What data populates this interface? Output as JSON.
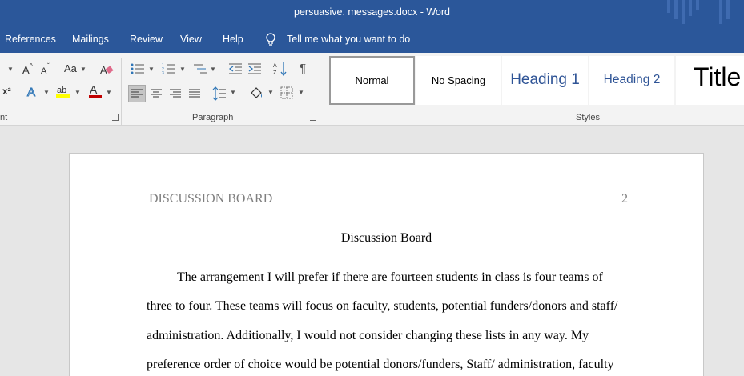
{
  "window": {
    "title": "persuasive. messages.docx  -  Word"
  },
  "ribbon_tabs": [
    {
      "label": "References"
    },
    {
      "label": "Mailings"
    },
    {
      "label": "Review"
    },
    {
      "label": "View"
    },
    {
      "label": "Help"
    }
  ],
  "tell_me": {
    "placeholder": "Tell me what you want to do"
  },
  "ribbon": {
    "font_group_label": "nt",
    "paragraph_group_label": "Paragraph",
    "styles_group_label": "Styles",
    "change_case_label": "Aa",
    "styles": [
      {
        "label": "Normal"
      },
      {
        "label": "No Spacing"
      },
      {
        "label": "Heading 1"
      },
      {
        "label": "Heading 2"
      },
      {
        "label": "Title"
      }
    ]
  },
  "document": {
    "header_left": "DISCUSSION BOARD",
    "page_number": "2",
    "title": "Discussion Board",
    "lines": [
      "The arrangement I will prefer if there are fourteen students in class is four teams of",
      "three to four. These teams will focus on faculty, students, potential funders/donors and staff/",
      "administration. Additionally, I would not consider changing these lists in any way. My",
      "preference order of choice would be potential donors/funders, Staff/ administration, faculty"
    ]
  },
  "colors": {
    "ribbon_blue": "#2b579a",
    "ribbon_bg": "#f3f3f3",
    "heading_blue": "#2f5496",
    "document_bg": "#e6e6e6"
  }
}
